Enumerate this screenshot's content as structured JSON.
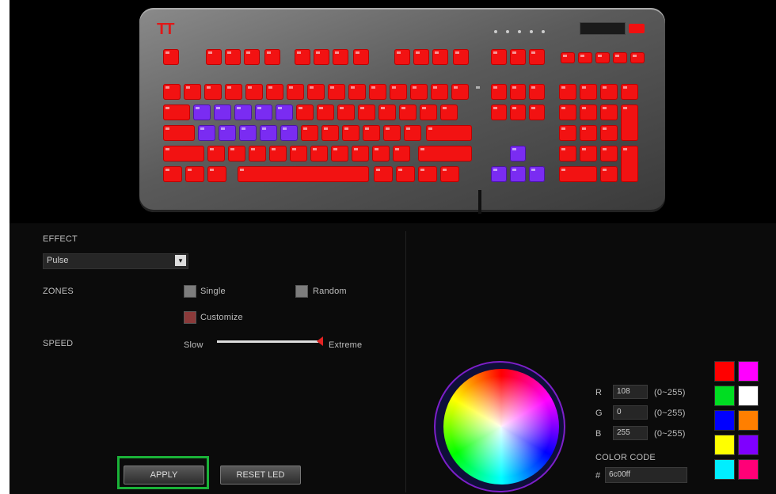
{
  "effect": {
    "label": "EFFECT",
    "selected": "Pulse"
  },
  "zones": {
    "label": "ZONES",
    "single": "Single",
    "random": "Random",
    "customize": "Customize",
    "customize_checked": true
  },
  "speed": {
    "label": "SPEED",
    "min_label": "Slow",
    "max_label": "Extreme",
    "value": 1.0
  },
  "buttons": {
    "apply": "APPLY",
    "reset": "RESET LED"
  },
  "color": {
    "r_label": "R",
    "g_label": "G",
    "b_label": "B",
    "r_value": "108",
    "g_value": "0",
    "b_value": "255",
    "range": "(0~255)",
    "code_label": "COLOR CODE",
    "hash": "#",
    "code_value": "6c00ff"
  },
  "swatches": [
    "#ff0000",
    "#ff00ff",
    "#00dd22",
    "#ffffff",
    "#0000ff",
    "#ff7f00",
    "#ffff00",
    "#7f00ff",
    "#00eeff",
    "#ff0077"
  ],
  "keyboard": {
    "logo": "TT",
    "key_color": "#f21212",
    "selected_color": "#7a2cf2"
  }
}
